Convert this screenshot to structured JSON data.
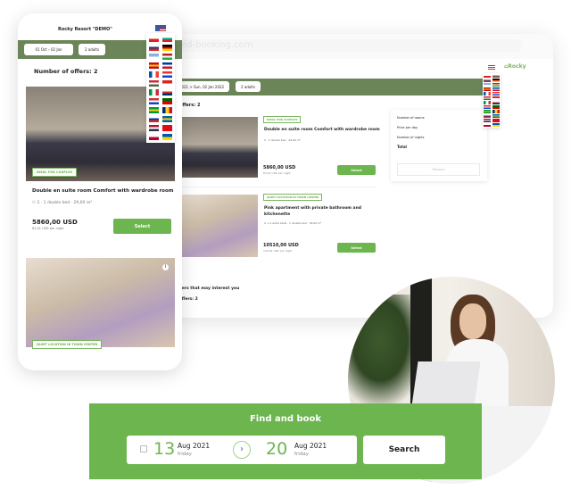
{
  "colors": {
    "accent": "#6cb54f",
    "header_bar": "#6b8559"
  },
  "desktop": {
    "address": "ed-booking.com",
    "logo": "Rocky",
    "dates": "2021 > Sun, 02 Jan 2022",
    "guests": "2 adults",
    "offers_count": "f offers: 2",
    "offers": [
      {
        "tag": "IDEAL FOR COUPLES",
        "title": "Double en suite room Comfort with wardrobe room",
        "details": "2 · 1 double bed · 29,00 m²",
        "price": "5860,00 USD",
        "per_night": "63,01 USD per night",
        "button": "Select"
      },
      {
        "tag": "QUIET LOCATION IN TOWN CENTER",
        "title": "Pink apartment with private bathroom and kitchenette",
        "details": "2 + 2 extra beds · 1 double bed · 39,00 m²",
        "price": "10510,00 USD",
        "per_night": "102,81 USD per night",
        "button": "Select"
      }
    ],
    "summary": {
      "rows": [
        "Number of rooms",
        "Price per day",
        "Number of nights"
      ],
      "total": "Total",
      "reserve": "Reserve"
    },
    "more_title": "offers that may interest you",
    "more_count": "f offers: 2"
  },
  "mobile": {
    "title": "Rocky Resort \"DEMO\"",
    "date_from": "01 Oct",
    "date_to": "02 Jan",
    "guests": "2 adults",
    "offers_count": "Number of offers: 2",
    "offer": {
      "tag": "IDEAL FOR COUPLES",
      "title": "Double en suite room Comfort with wardrobe room",
      "guests": "2",
      "bed": "1 double bed",
      "size": "29,00 m²",
      "price": "5860,00 USD",
      "per_night": "63,01 USD per night",
      "button": "Select"
    },
    "offer2_tag": "QUIET LOCATION IN TOWN CENTER"
  },
  "flags": [
    [
      "#fff",
      "#d22"
    ],
    [
      "#fff",
      "#0a8",
      "#d22"
    ],
    [
      "#fff",
      "#11457e",
      "#d22"
    ],
    [
      "#000",
      "#d00",
      "#fc0"
    ],
    [
      "#8ab4e0",
      "#fff"
    ],
    [
      "#b22",
      "#fff",
      "#2a4"
    ],
    [
      "#c60b1e",
      "#fc0",
      "#c60b1e"
    ],
    [
      "#0038a8",
      "#fff",
      "#ce1126"
    ],
    [
      "#0055a4",
      "#fff",
      "#ef4135"
    ],
    [
      "#e33",
      "#fff",
      "#14c"
    ],
    [
      "#cd2a3e",
      "#fff",
      "#436f4d"
    ],
    [
      "#d22",
      "#fff"
    ],
    [
      "#009246",
      "#fff",
      "#ce2b37"
    ],
    [
      "#fff",
      "#c33",
      "#036"
    ],
    [
      "#c33",
      "#fff",
      "#14c"
    ],
    [
      "#060",
      "#d00"
    ],
    [
      "#093",
      "#fc0",
      "#093"
    ],
    [
      "#002b7f",
      "#fcd116",
      "#ce1126"
    ],
    [
      "#fff",
      "#0039a6",
      "#d52b1e"
    ],
    [
      "#06a",
      "#fc0",
      "#06a"
    ],
    [
      "#a51931",
      "#fff",
      "#2d2a4a"
    ],
    [
      "#e30a17",
      "#e30a17"
    ],
    [
      "#fff",
      "#bc002d"
    ],
    [
      "#0057b7",
      "#ffd700"
    ]
  ],
  "find": {
    "title": "Find and book",
    "from_day": "13",
    "from_month": "Aug 2021",
    "from_weekday": "friday",
    "to_day": "20",
    "to_month": "Aug 2021",
    "to_weekday": "friday",
    "search": "Search"
  }
}
